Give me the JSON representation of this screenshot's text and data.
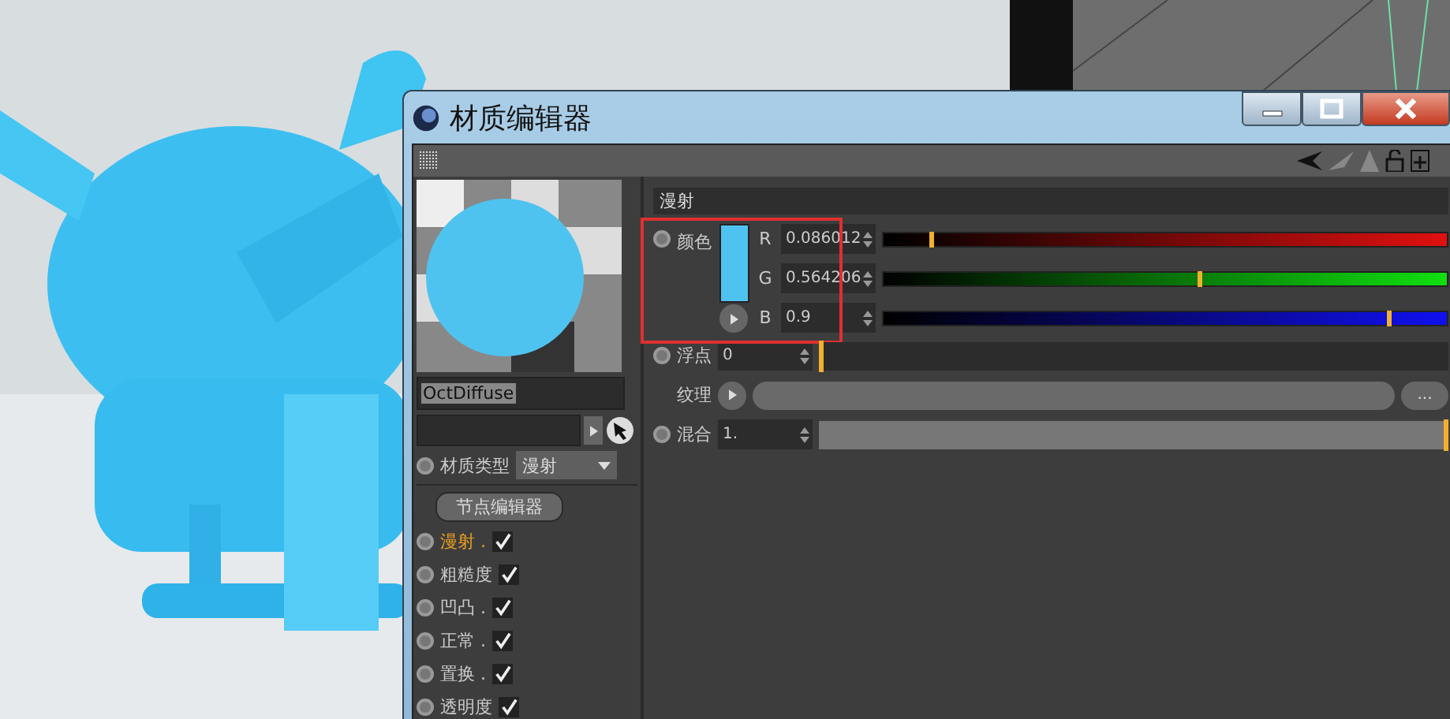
{
  "window": {
    "title": "材质编辑器"
  },
  "material_name": "OctDiffuse",
  "material_type": {
    "label": "材质类型",
    "value": "漫射"
  },
  "node_editor_button": "节点编辑器",
  "channels": [
    {
      "label": "漫射 .",
      "selected": true,
      "checked": true
    },
    {
      "label": "粗糙度",
      "selected": false,
      "checked": true
    },
    {
      "label": "凹凸 .",
      "selected": false,
      "checked": true
    },
    {
      "label": "正常 .",
      "selected": false,
      "checked": true
    },
    {
      "label": "置换 .",
      "selected": false,
      "checked": true
    },
    {
      "label": "透明度",
      "selected": false,
      "checked": true
    }
  ],
  "section": {
    "title": "漫射"
  },
  "color": {
    "label": "颜色",
    "components": [
      {
        "name": "R",
        "value": "0.086012",
        "level": 0.086,
        "color": "#e01010"
      },
      {
        "name": "G",
        "value": "0.564206",
        "level": 0.564,
        "color": "#10e010"
      },
      {
        "name": "B",
        "value": "0.9",
        "level": 0.9,
        "color": "#1010f0"
      }
    ]
  },
  "float": {
    "label": "浮点",
    "value": "0",
    "level": 0
  },
  "texture": {
    "label": "纹理",
    "more": "..."
  },
  "mix": {
    "label": "混合",
    "value": "1.",
    "level": 1
  }
}
